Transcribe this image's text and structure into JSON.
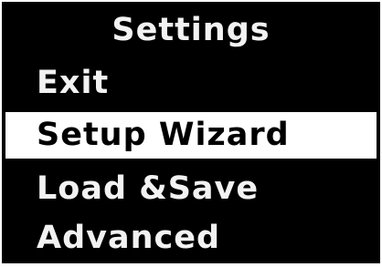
{
  "screen": {
    "title": "Settings",
    "selected_index": 1,
    "colors": {
      "background": "#000000",
      "text": "#f2f2f2",
      "highlight_background": "#ffffff",
      "highlight_text": "#000000"
    },
    "menu": [
      {
        "label": "Exit"
      },
      {
        "label": "Setup Wizard"
      },
      {
        "label": "Load &Save"
      },
      {
        "label": "Advanced"
      }
    ]
  }
}
